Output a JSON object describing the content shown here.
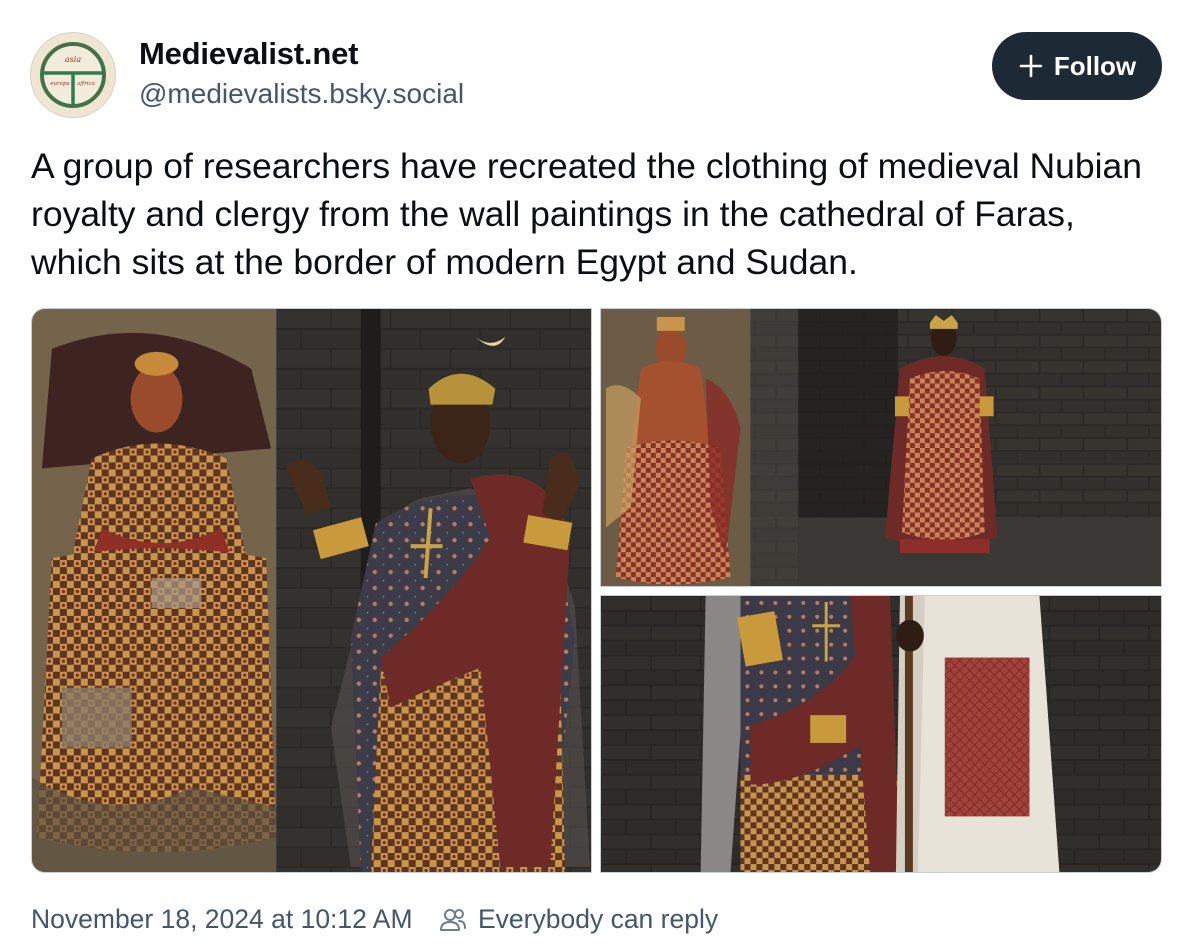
{
  "author": {
    "display_name": "Medievalist.net",
    "handle": "@medievalists.bsky.social",
    "avatar_icon": "medieval-t-o-map-avatar",
    "avatar_text": [
      "asia",
      "europa",
      "affrica"
    ]
  },
  "follow_button": {
    "label": "Follow",
    "icon": "plus-icon"
  },
  "post": {
    "text": "A group of researchers have recreated the clothing of medieval Nubian royalty and clergy from the wall paintings in the cathedral of Faras, which sits at the border of modern Egypt and Sudan."
  },
  "images": [
    {
      "subject": "fresco of Nubian clergyman beside man in recreated bishop's robes with crescent crown"
    },
    {
      "subject": "fresco of Nubian queen beside woman in recreated royal dress with crown"
    },
    {
      "subject": "close-up of recreated patterned robes and white garment with red panel"
    }
  ],
  "footer": {
    "timestamp": "November 18, 2024 at 10:12 AM",
    "reply_icon": "people-icon",
    "reply_setting": "Everybody can reply"
  },
  "colors": {
    "follow_bg": "#1e2936",
    "muted_text": "#42576c",
    "body_text": "#0b0f14"
  }
}
